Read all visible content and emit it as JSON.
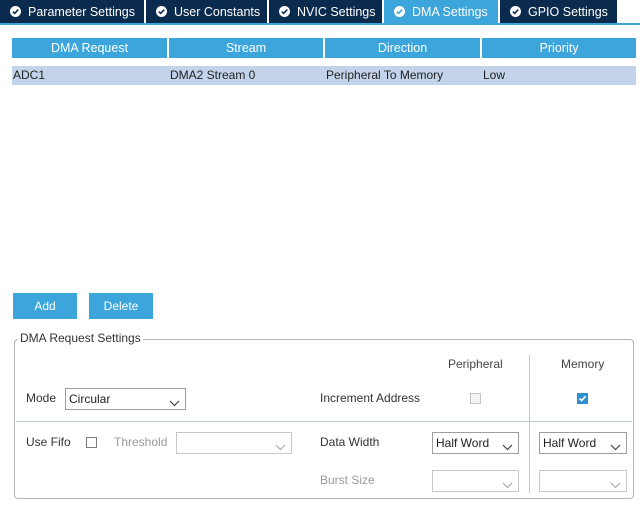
{
  "tabs": [
    {
      "label": "Parameter Settings",
      "active": false
    },
    {
      "label": "User Constants",
      "active": false
    },
    {
      "label": "NVIC Settings",
      "active": false
    },
    {
      "label": "DMA Settings",
      "active": true
    },
    {
      "label": "GPIO Settings",
      "active": false
    }
  ],
  "table": {
    "columns": [
      "DMA Request",
      "Stream",
      "Direction",
      "Priority"
    ],
    "rows": [
      [
        "ADC1",
        "DMA2 Stream 0",
        "Peripheral To Memory",
        "Low"
      ]
    ]
  },
  "buttons": {
    "add": "Add",
    "delete": "Delete"
  },
  "settings": {
    "title": "DMA Request Settings",
    "peripheral_header": "Peripheral",
    "memory_header": "Memory",
    "mode_label": "Mode",
    "mode_value": "Circular",
    "increment_label": "Increment Address",
    "increment_peripheral": false,
    "increment_memory": true,
    "use_fifo_label": "Use Fifo",
    "use_fifo": false,
    "threshold_label": "Threshold",
    "threshold_value": "",
    "data_width_label": "Data Width",
    "data_width_peripheral": "Half Word",
    "data_width_memory": "Half Word",
    "burst_label": "Burst Size",
    "burst_peripheral": "",
    "burst_memory": ""
  },
  "colors": {
    "tab_bg": "#0a2b4e",
    "tab_active": "#3ca5dc",
    "row_selected": "#c3d3ea"
  }
}
